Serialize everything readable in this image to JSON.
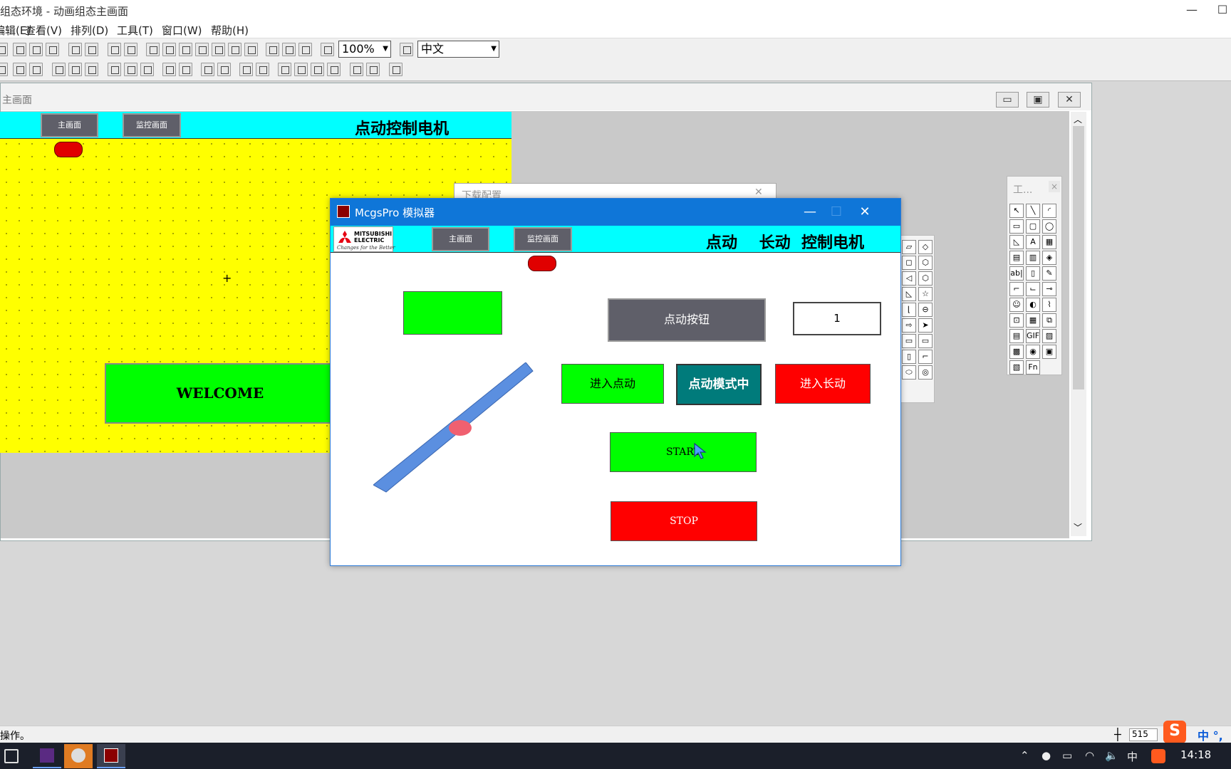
{
  "app": {
    "title": "组态环境 - 动画组态主画面",
    "min_symbol": "—",
    "max_symbol": "☐"
  },
  "menu": [
    "编辑(E)",
    "查看(V)",
    "排列(D)",
    "工具(T)",
    "窗口(W)",
    "帮助(H)"
  ],
  "toolbar": {
    "zoom": "100%",
    "language": "中文"
  },
  "editor": {
    "title": "主画面",
    "min_symbol": "▭",
    "restore_symbol": "▣",
    "close_symbol": "✕",
    "canvas": {
      "nav_main": "主画面",
      "nav_monitor": "监控画面",
      "title": "点动控制电机",
      "welcome": "WELCOME",
      "crosshair": "+"
    }
  },
  "download_window": {
    "title": "下载配置"
  },
  "toolbox": {
    "title": "工...",
    "close_symbol": "×",
    "tools": [
      "↖",
      "╲",
      "◜",
      "▭",
      "▢",
      "◯",
      "◺",
      "A",
      "▦",
      "▤",
      "▥",
      "◈",
      "ab|",
      "▯",
      "✎",
      "⌐",
      "⌙",
      "⊸",
      "☺",
      "◐",
      "⌇",
      "⊡",
      "▦",
      "⧉",
      "▤",
      "GIF",
      "▨",
      "▩",
      "◉",
      "▣",
      "▧",
      "Fn"
    ]
  },
  "toolbox2": {
    "tools": [
      "▱",
      "◇",
      "◻",
      "⬡",
      "◁",
      "⬡",
      "◺",
      "☆",
      "⌊",
      "⊖",
      "⇨",
      "➤",
      "▭",
      "▭",
      "▯",
      "⌐",
      "⬭",
      "◎"
    ]
  },
  "simulator": {
    "title": "McgsPro 模拟器",
    "min_symbol": "—",
    "max_symbol": "☐",
    "close_symbol": "✕",
    "logo_text": "MITSUBISHI\nELECTRIC",
    "logo_slogan": "Changes for the Better",
    "nav_main": "主画面",
    "nav_monitor": "监控画面",
    "header_title": "点动    长动  控制电机",
    "jog_button": "点动按钮",
    "counter": "1",
    "enter_jog": "进入点动",
    "jog_mode": "点动模式中",
    "enter_long": "进入长动",
    "start": "START",
    "stop": "STOP"
  },
  "status": {
    "text": "操作。",
    "coord_icon": "┼",
    "coord": "515",
    "ime_icon": "S",
    "ime_lang": "中 °,"
  },
  "taskbar": {
    "time": "14:18",
    "tray_chevron": "⌃",
    "tray_network": "◠",
    "tray_volume": "🔈",
    "tray_ime": "中"
  },
  "colors": {
    "yellow_canvas": "#ffff00",
    "cyan_header": "#00ffff",
    "green": "#00ff00",
    "red": "#ff0000",
    "teal": "#007b7b",
    "simulator_titlebar": "#0f76d8"
  }
}
